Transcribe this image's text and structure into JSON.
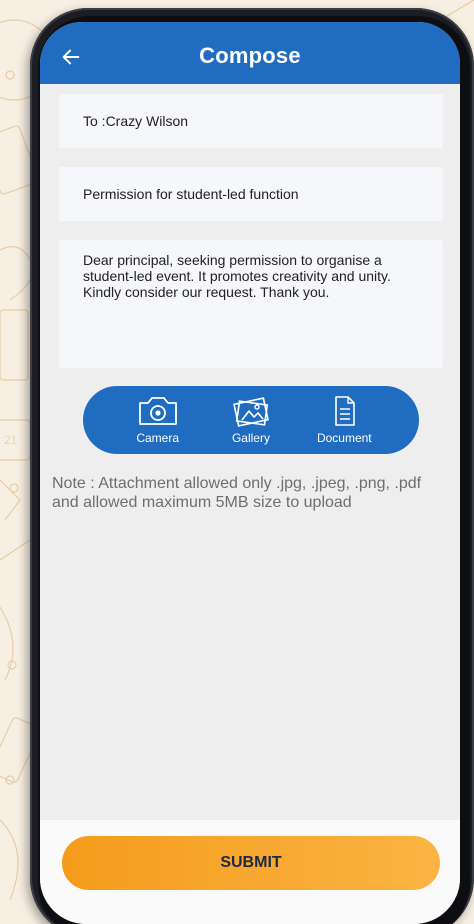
{
  "header": {
    "title": "Compose",
    "back_icon": "arrow-left-icon"
  },
  "compose": {
    "to_value": "To :Crazy Wilson",
    "subject_value": "Permission for student-led function",
    "body_value": "Dear principal, seeking permission to organise a student-led event. It promotes creativity and unity. Kindly consider our request. Thank you."
  },
  "attachments": {
    "camera_label": "Camera",
    "gallery_label": "Gallery",
    "document_label": "Document"
  },
  "note": "Note : Attachment allowed only .jpg, .jpeg, .png, .pdf and allowed maximum 5MB size to upload",
  "submit_label": "SUBMIT",
  "colors": {
    "primary": "#1f6cc0",
    "accent_start": "#f59b1c",
    "accent_end": "#fbb443",
    "background": "#eeeeee"
  }
}
